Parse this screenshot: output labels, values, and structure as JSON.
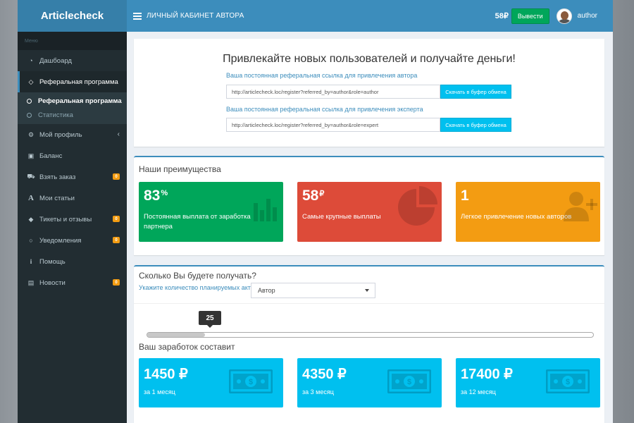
{
  "app": {
    "logo": "Articlecheck"
  },
  "header": {
    "title": "ЛИЧНЫЙ КАБИНЕТ АВТОРА",
    "balance": "58₽",
    "withdraw_label": "Вывести",
    "username": "author"
  },
  "sidebar": {
    "menu_header": "Меню",
    "items": [
      {
        "label": "Дашбоард",
        "icon": "dashboard-icon"
      },
      {
        "label": "Реферальная программа",
        "icon": "diamond-icon",
        "active": true
      },
      {
        "label": "Мой профиль",
        "icon": "gears-icon"
      },
      {
        "label": "Баланс",
        "icon": "money-icon"
      },
      {
        "label": "Взять заказ",
        "icon": "cart-icon",
        "badge": "0"
      },
      {
        "label": "Мои статьи",
        "icon": "font-icon"
      },
      {
        "label": "Тикеты и отзывы",
        "icon": "tag-icon",
        "badge": "0"
      },
      {
        "label": "Уведомления",
        "icon": "comment-icon",
        "badge": "0"
      },
      {
        "label": "Помощь",
        "icon": "info-icon"
      },
      {
        "label": "Новости",
        "icon": "newspaper-icon",
        "badge": "0"
      }
    ],
    "subitems": [
      {
        "label": "Реферальная программа",
        "active": true
      },
      {
        "label": "Статистика"
      }
    ]
  },
  "referral": {
    "title": "Привлекайте новых пользователей и получайте деньги!",
    "author_label": "Ваша постоянная реферальная ссылка для привлечения автора",
    "author_link": "http://articlecheck.loc/register?referred_by=author&role=author",
    "expert_label": "Ваша постоянная реферальная ссылка для привлечения эксперта",
    "expert_link": "http://articlecheck.loc/register?referred_by=author&role=expert",
    "copy_label": "Скачать в буфер обмена"
  },
  "advantages": {
    "title": "Наши преимущества",
    "tiles": [
      {
        "value": "83",
        "unit": "%",
        "desc": "Постоянная выплата от заработка партнера",
        "color": "#00a65a",
        "icon": "bar-chart-icon"
      },
      {
        "value": "58",
        "unit": "₽",
        "desc": "Самые крупные выплаты",
        "color": "#dd4b39",
        "icon": "pie-chart-icon"
      },
      {
        "value": "1",
        "unit": "",
        "desc": "Легкое привлечение новых авторов",
        "color": "#f39c12",
        "icon": "user-plus-icon"
      }
    ]
  },
  "calculator": {
    "title": "Сколько Вы будете получать?",
    "subtitle": "Укажите количество планируемых активных",
    "select_value": "Автор",
    "slider_value": "25",
    "slider_fraction": 0.13,
    "earnings_title": "Ваш заработок составит",
    "earnings": [
      {
        "value": "1450 ₽",
        "period": "за 1 месяц"
      },
      {
        "value": "4350 ₽",
        "period": "за 3 месяц"
      },
      {
        "value": "17400 ₽",
        "period": "за 12 месяц"
      }
    ]
  }
}
